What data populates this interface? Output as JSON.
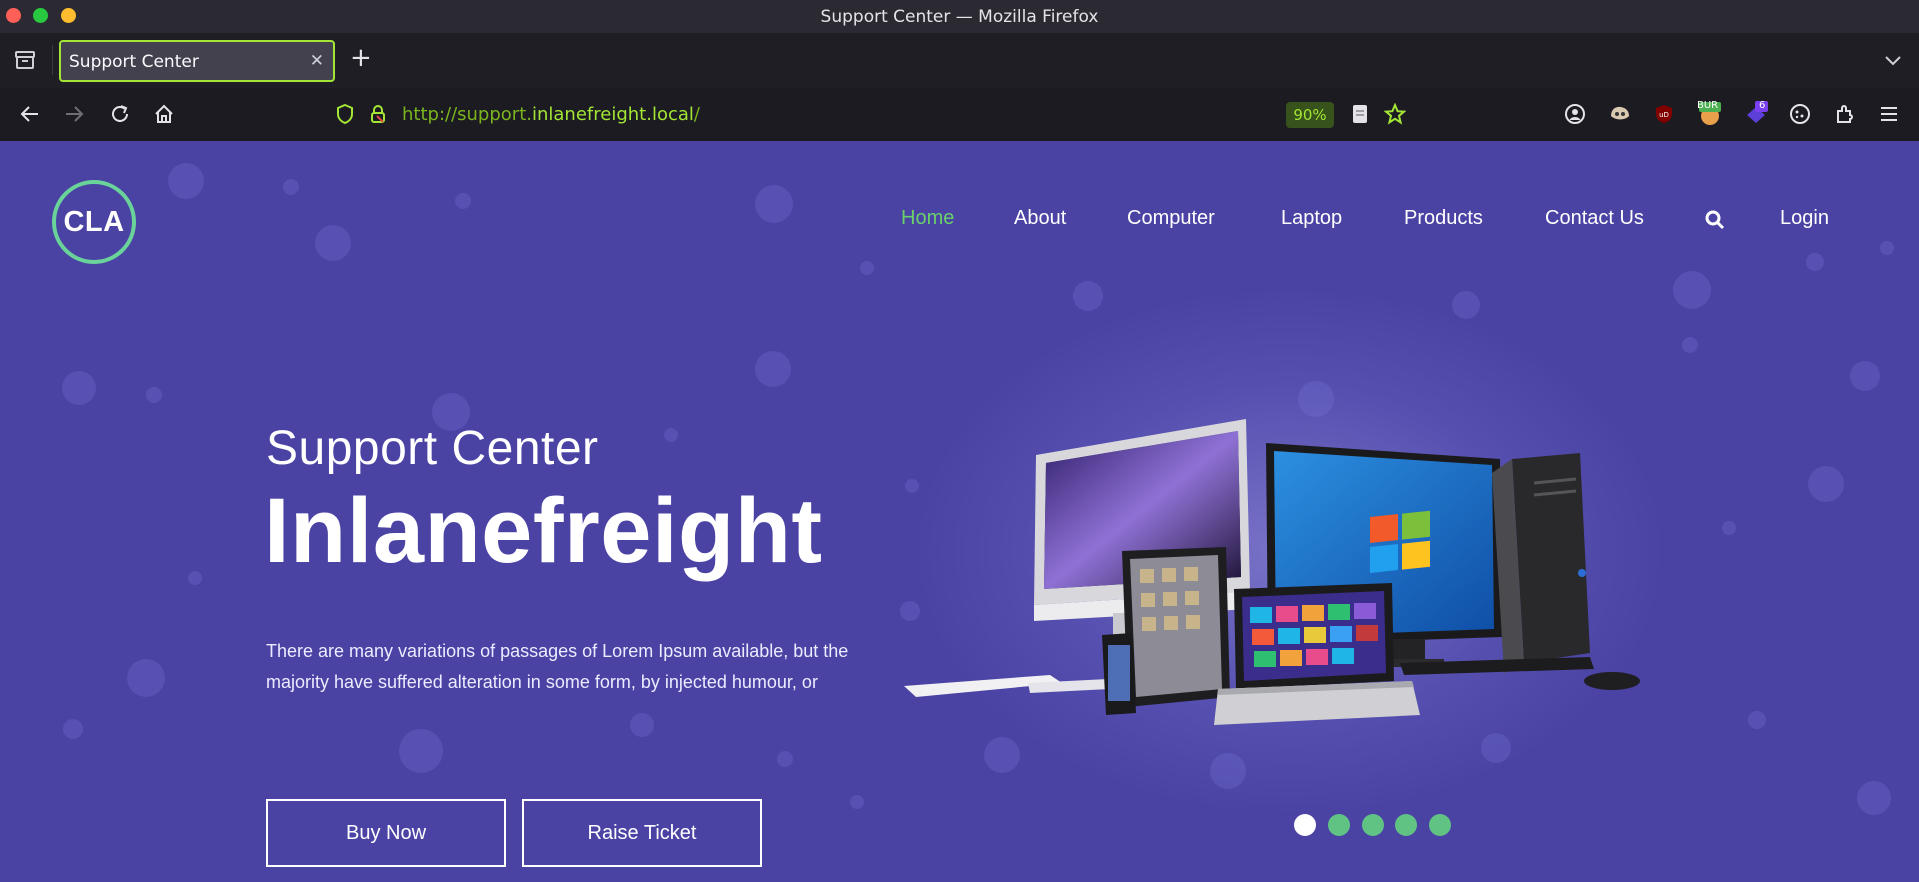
{
  "window": {
    "title": "Support Center — Mozilla Firefox"
  },
  "tabs": [
    {
      "label": "Support Center",
      "active": true
    }
  ],
  "toolbar": {
    "url_prefix": "http://support.",
    "url_domain": "inlanefreight.local",
    "url_suffix": "/",
    "zoom": "90%"
  },
  "extensions": {
    "burp_badge": "BUR",
    "count_badge": "6"
  },
  "site": {
    "logo": "CLA",
    "nav": [
      "Home",
      "About",
      "Computer",
      "Laptop",
      "Products",
      "Contact Us"
    ],
    "nav_active": "Home",
    "login": "Login",
    "hero_subtitle": "Support Center",
    "hero_title": "Inlanefreight",
    "hero_body": "There are many variations of passages of Lorem Ipsum available, but the majority have suffered alteration in some form, by injected humour, or",
    "buy_label": "Buy Now",
    "ticket_label": "Raise Ticket",
    "carousel_total": 5,
    "carousel_active": 1
  },
  "colors": {
    "page_bg": "#4a43a4",
    "accent_green": "#6ad06a",
    "dot_green": "#60c384",
    "url_green": "#a3e635"
  }
}
